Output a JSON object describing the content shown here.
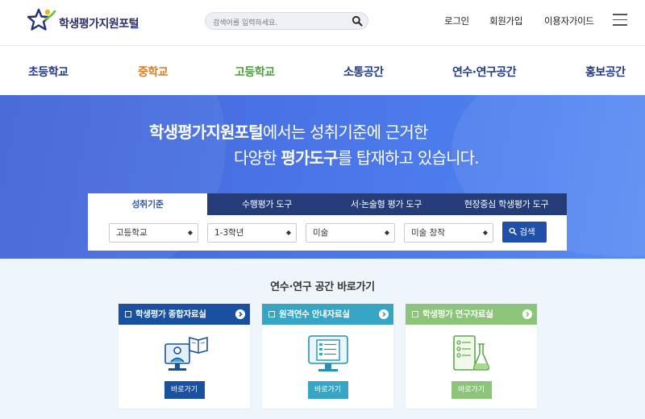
{
  "header": {
    "logo_text": "학생평가지원포털",
    "search_placeholder": "검색어를 입력하세요.",
    "util_links": [
      "로그인",
      "회원가입",
      "이용자가이드"
    ]
  },
  "gnb": [
    {
      "label": "초등학교",
      "color": "#1e3a8a"
    },
    {
      "label": "중학교",
      "color": "#e07b1f"
    },
    {
      "label": "고등학교",
      "color": "#4aa03a"
    },
    {
      "label": "소통공간",
      "color": "#1e3a8a"
    },
    {
      "label": "연수·연구공간",
      "color": "#1e3a8a"
    },
    {
      "label": "홍보공간",
      "color": "#1e3a8a"
    }
  ],
  "hero": {
    "line1_bold": "학생평가지원포털",
    "line1_rest": "에서는 성취기준에 근거한",
    "line2_pre": "다양한 ",
    "line2_bold": "평가도구",
    "line2_post": "를 탑재하고 있습니다."
  },
  "search_tabs": [
    "성취기준",
    "수행평가 도구",
    "서·논술형 평가 도구",
    "현장중심 학생평가 도구"
  ],
  "filters": {
    "school": "고등학교",
    "grade": "1-3학년",
    "subject": "미술",
    "unit": "미술 창작",
    "search_label": "검색"
  },
  "shortcut": {
    "title": "연수·연구 공간 바로가기",
    "cards": [
      {
        "label": "학생평가 종합자료실",
        "color": "#1a50a0",
        "button": "바로가기",
        "icon": "teacher-lecture-icon"
      },
      {
        "label": "원격연수 안내자료실",
        "color": "#36a6c4",
        "button": "바로가기",
        "icon": "monitor-document-icon"
      },
      {
        "label": "학생평가 연구자료실",
        "color": "#8cc47a",
        "button": "바로가기",
        "icon": "research-flask-icon"
      }
    ]
  }
}
